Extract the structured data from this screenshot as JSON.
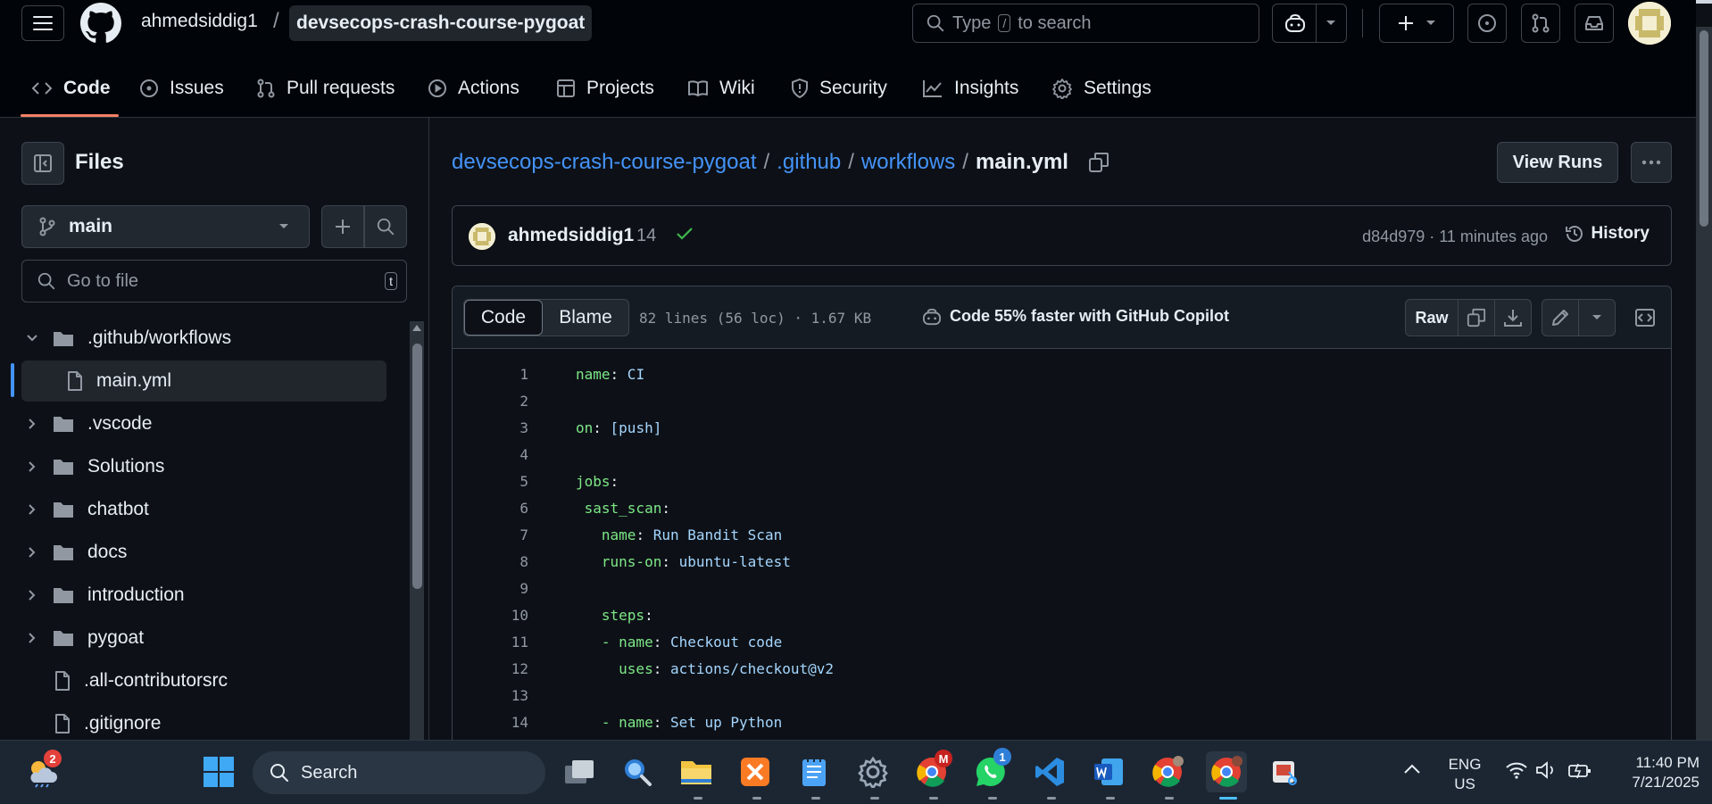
{
  "header": {
    "owner": "ahmedsiddig1",
    "slash": "/",
    "repo": "devsecops-crash-course-pygoat",
    "search_prefix": "Type",
    "search_key": "/",
    "search_suffix": "to search"
  },
  "nav": {
    "items": [
      {
        "label": "Code",
        "icon": "code-icon"
      },
      {
        "label": "Issues",
        "icon": "issue-icon"
      },
      {
        "label": "Pull requests",
        "icon": "pull-request-icon"
      },
      {
        "label": "Actions",
        "icon": "play-icon"
      },
      {
        "label": "Projects",
        "icon": "table-icon"
      },
      {
        "label": "Wiki",
        "icon": "book-icon"
      },
      {
        "label": "Security",
        "icon": "shield-icon"
      },
      {
        "label": "Insights",
        "icon": "graph-icon"
      },
      {
        "label": "Settings",
        "icon": "gear-icon"
      }
    ],
    "active": "Code"
  },
  "sidebar": {
    "title": "Files",
    "branch": "main",
    "goto_placeholder": "Go to file",
    "goto_key": "t",
    "tree": [
      {
        "label": ".github/workflows",
        "type": "folder",
        "expanded": true
      },
      {
        "label": "main.yml",
        "type": "file",
        "selected": true
      },
      {
        "label": ".vscode",
        "type": "folder"
      },
      {
        "label": "Solutions",
        "type": "folder"
      },
      {
        "label": "chatbot",
        "type": "folder"
      },
      {
        "label": "docs",
        "type": "folder"
      },
      {
        "label": "introduction",
        "type": "folder"
      },
      {
        "label": "pygoat",
        "type": "folder"
      },
      {
        "label": ".all-contributorsrc",
        "type": "file"
      },
      {
        "label": ".gitignore",
        "type": "file"
      }
    ]
  },
  "main": {
    "breadcrumb": {
      "repo": "devsecops-crash-course-pygoat",
      "dir1": ".github",
      "dir2": "workflows",
      "file": "main.yml",
      "sep": "/"
    },
    "view_runs": "View Runs",
    "commit": {
      "author": "ahmedsiddig1",
      "count": "14",
      "sha_time": "d84d979 · 11 minutes ago",
      "history": "History"
    },
    "code_toolbar": {
      "tab_code": "Code",
      "tab_blame": "Blame",
      "stats": "82 lines (56 loc) · 1.67 KB",
      "copilot": "Code 55% faster with GitHub Copilot",
      "raw": "Raw"
    },
    "lines": [
      {
        "n": "1",
        "key": "name",
        "val": " CI"
      },
      {
        "n": "2",
        "key": "",
        "val": ""
      },
      {
        "n": "3",
        "key": "on",
        "val": " [push]"
      },
      {
        "n": "4",
        "key": "",
        "val": ""
      },
      {
        "n": "5",
        "key": "jobs",
        "val": ""
      },
      {
        "n": "6",
        "key": " sast_scan",
        "val": ""
      },
      {
        "n": "7",
        "key": "   name",
        "val": " Run Bandit Scan"
      },
      {
        "n": "8",
        "key": "   runs-on",
        "val": " ubuntu-latest"
      },
      {
        "n": "9",
        "key": "",
        "val": ""
      },
      {
        "n": "10",
        "key": "   steps",
        "val": ""
      },
      {
        "n": "11",
        "key": "   - name",
        "val": " Checkout code"
      },
      {
        "n": "12",
        "key": "     uses",
        "val": " actions/checkout@v2"
      },
      {
        "n": "13",
        "key": "",
        "val": ""
      },
      {
        "n": "14",
        "key": "   - name",
        "val": " Set up Python"
      }
    ]
  },
  "taskbar": {
    "search": "Search",
    "weather_badge": "2",
    "gmail_badge": "M",
    "whatsapp_badge": "1",
    "lang_top": "ENG",
    "lang_bottom": "US",
    "time": "11:40 PM",
    "date": "7/21/2025"
  },
  "colors": {
    "accent_blue": "#4493f8",
    "nav_underline": "#f78166",
    "success_check": "#3fb950",
    "yaml_key": "#7ee787",
    "yaml_value": "#a5d6ff"
  }
}
